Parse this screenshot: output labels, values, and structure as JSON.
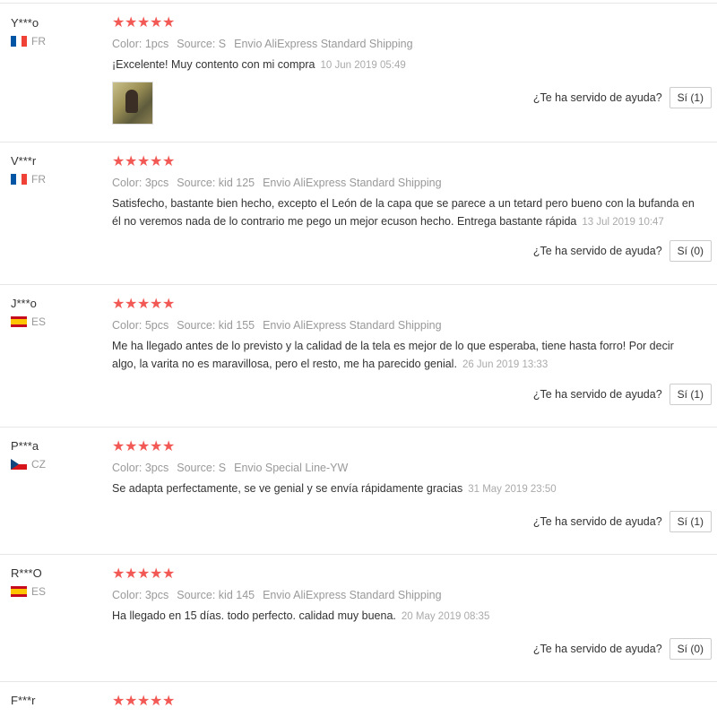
{
  "reviews": [
    {
      "user": "Y***o",
      "country": "FR",
      "flag": "fr",
      "color": "Color: 1pcs",
      "source": "Source: S",
      "shipping": "Envio AliExpress Standard Shipping",
      "text": "¡Excelente! Muy contento con mi compra",
      "date": "10 Jun 2019 05:49",
      "has_photo": true,
      "helpful_q": "¿Te ha servido de ayuda?",
      "yes": "Sí (1)"
    },
    {
      "user": "V***r",
      "country": "FR",
      "flag": "fr",
      "color": "Color: 3pcs",
      "source": "Source: kid 125",
      "shipping": "Envio AliExpress Standard Shipping",
      "text": "Satisfecho, bastante bien hecho, excepto el León de la capa que se parece a un tetard pero bueno con la bufanda en él no veremos nada de lo contrario me pego un mejor ecuson hecho. Entrega bastante rápida",
      "date": "13 Jul 2019 10:47",
      "has_photo": false,
      "helpful_q": "¿Te ha servido de ayuda?",
      "yes": "Sí (0)"
    },
    {
      "user": "J***o",
      "country": "ES",
      "flag": "es",
      "color": "Color: 5pcs",
      "source": "Source: kid 155",
      "shipping": "Envio AliExpress Standard Shipping",
      "text": "Me ha llegado antes de lo previsto y la calidad de la tela es mejor de lo que esperaba, tiene hasta forro! Por decir algo, la varita no es maravillosa, pero el resto, me ha parecido genial.",
      "date": "26 Jun 2019 13:33",
      "has_photo": false,
      "helpful_q": "¿Te ha servido de ayuda?",
      "yes": "Sí (1)"
    },
    {
      "user": "P***a",
      "country": "CZ",
      "flag": "cz",
      "color": "Color: 3pcs",
      "source": "Source: S",
      "shipping": "Envio Special Line-YW",
      "text": "Se adapta perfectamente, se ve genial y se envía rápidamente gracias",
      "date": "31 May 2019 23:50",
      "has_photo": false,
      "helpful_q": "¿Te ha servido de ayuda?",
      "yes": "Sí (1)"
    },
    {
      "user": "R***O",
      "country": "ES",
      "flag": "es",
      "color": "Color: 3pcs",
      "source": "Source: kid 145",
      "shipping": "Envio AliExpress Standard Shipping",
      "text": "Ha llegado en 15 días. todo perfecto. calidad muy buena.",
      "date": "20 May 2019 08:35",
      "has_photo": false,
      "helpful_q": "¿Te ha servido de ayuda?",
      "yes": "Sí (0)"
    },
    {
      "user": "F***r"
    }
  ],
  "colors": {
    "star": "#f25955",
    "muted": "#999999",
    "border": "#e6e6e6"
  }
}
